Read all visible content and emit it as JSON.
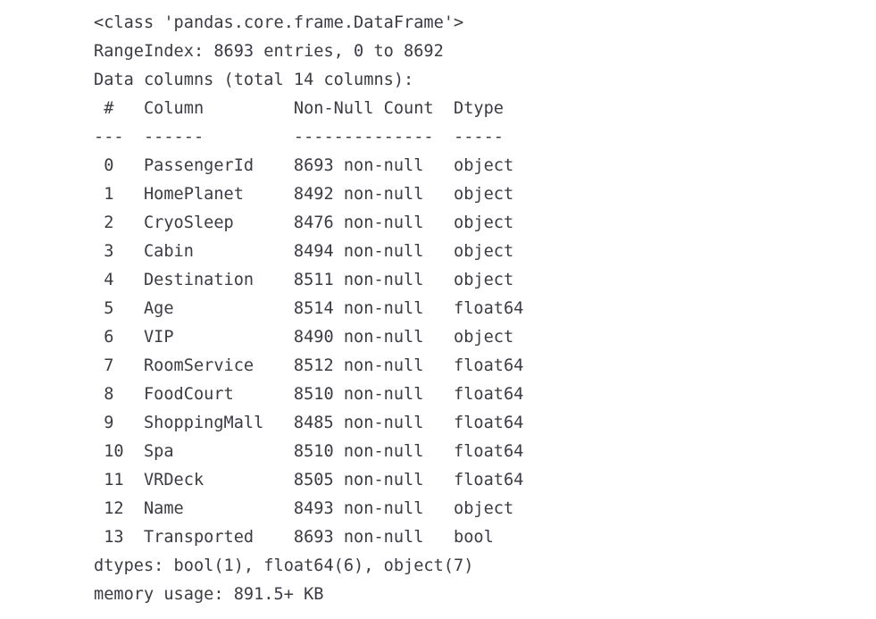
{
  "console": {
    "background_color": "#ffffff",
    "text_color": "#3b3b45",
    "header": {
      "class_line": "<class 'pandas.core.frame.DataFrame'>",
      "range_index_line": "RangeIndex: 8693 entries, 0 to 8692",
      "data_columns_line": "Data columns (total 14 columns):",
      "column_header_line": " #   Column         Non-Null Count  Dtype ",
      "separator_line": "---  ------         --------------  ----- "
    },
    "columns": [
      {
        "index": "0",
        "name": "PassengerId",
        "non_null": "8693 non-null",
        "dtype": "object",
        "line": " 0   PassengerId    8693 non-null   object "
      },
      {
        "index": "1",
        "name": "HomePlanet",
        "non_null": "8492 non-null",
        "dtype": "object",
        "line": " 1   HomePlanet     8492 non-null   object "
      },
      {
        "index": "2",
        "name": "CryoSleep",
        "non_null": "8476 non-null",
        "dtype": "object",
        "line": " 2   CryoSleep      8476 non-null   object "
      },
      {
        "index": "3",
        "name": "Cabin",
        "non_null": "8494 non-null",
        "dtype": "object",
        "line": " 3   Cabin          8494 non-null   object "
      },
      {
        "index": "4",
        "name": "Destination",
        "non_null": "8511 non-null",
        "dtype": "object",
        "line": " 4   Destination    8511 non-null   object "
      },
      {
        "index": "5",
        "name": "Age",
        "non_null": "8514 non-null",
        "dtype": "float64",
        "line": " 5   Age            8514 non-null   float64"
      },
      {
        "index": "6",
        "name": "VIP",
        "non_null": "8490 non-null",
        "dtype": "object",
        "line": " 6   VIP            8490 non-null   object "
      },
      {
        "index": "7",
        "name": "RoomService",
        "non_null": "8512 non-null",
        "dtype": "float64",
        "line": " 7   RoomService    8512 non-null   float64"
      },
      {
        "index": "8",
        "name": "FoodCourt",
        "non_null": "8510 non-null",
        "dtype": "float64",
        "line": " 8   FoodCourt      8510 non-null   float64"
      },
      {
        "index": "9",
        "name": "ShoppingMall",
        "non_null": "8485 non-null",
        "dtype": "float64",
        "line": " 9   ShoppingMall   8485 non-null   float64"
      },
      {
        "index": "10",
        "name": "Spa",
        "non_null": "8510 non-null",
        "dtype": "float64",
        "line": " 10  Spa            8510 non-null   float64"
      },
      {
        "index": "11",
        "name": "VRDeck",
        "non_null": "8505 non-null",
        "dtype": "float64",
        "line": " 11  VRDeck         8505 non-null   float64"
      },
      {
        "index": "12",
        "name": "Name",
        "non_null": "8493 non-null",
        "dtype": "object",
        "line": " 12  Name           8493 non-null   object "
      },
      {
        "index": "13",
        "name": "Transported",
        "non_null": "8693 non-null",
        "dtype": "bool",
        "line": " 13  Transported    8693 non-null   bool   "
      }
    ],
    "footer": {
      "dtypes_line": "dtypes: bool(1), float64(6), object(7)",
      "memory_usage_line": "memory usage: 891.5+ KB"
    },
    "summary": {
      "total_entries": "8693",
      "index_start": "0",
      "index_end": "8692",
      "total_columns": "14",
      "dtype_counts": {
        "bool": "1",
        "float64": "6",
        "object": "7"
      },
      "memory_usage": "891.5+ KB",
      "column_header_labels": [
        "#",
        "Column",
        "Non-Null Count",
        "Dtype"
      ]
    }
  }
}
